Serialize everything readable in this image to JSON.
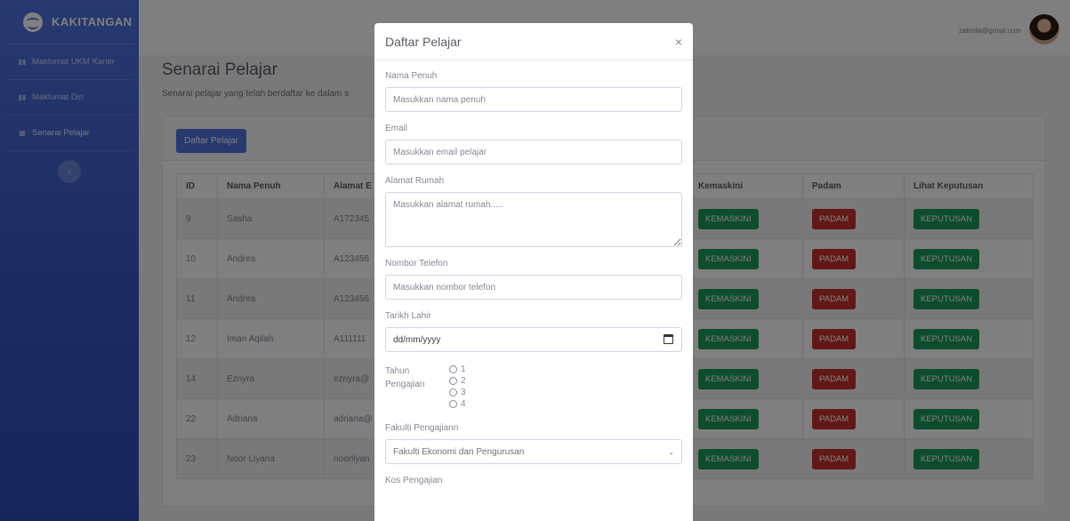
{
  "sidebar": {
    "brand": "KAKITANGAN",
    "items": [
      {
        "icon": "chart-icon",
        "label": "Maklumat UKM Karier"
      },
      {
        "icon": "chart-icon",
        "label": "Maklumat Diri"
      },
      {
        "icon": "table-icon",
        "label": "Senarai Pelajar"
      }
    ],
    "toggle_glyph": "‹"
  },
  "topbar": {
    "user_email": "zalinda@gmail.com"
  },
  "page": {
    "title": "Senarai Pelajar",
    "subtitle": "Senarai pelajar yang telah berdaftar ke dalam s",
    "add_button": "Daftar Pelajar"
  },
  "table": {
    "headers": [
      "ID",
      "Nama Penuh",
      "Alamat E",
      "Kemaskini",
      "Padam",
      "Lihat Keputusan"
    ],
    "rows": [
      {
        "id": "9",
        "name": "Sasha",
        "email": "A172345"
      },
      {
        "id": "10",
        "name": "Andrea",
        "email": "A123456"
      },
      {
        "id": "11",
        "name": "Andrea",
        "email": "A123456"
      },
      {
        "id": "12",
        "name": "Iman Aqilah",
        "email": "A111111"
      },
      {
        "id": "14",
        "name": "Eznyra",
        "email": "eznyra@"
      },
      {
        "id": "22",
        "name": "Adriana",
        "email": "adriana@"
      },
      {
        "id": "23",
        "name": "Noor Liyana",
        "email": "noorliyan"
      }
    ],
    "edit_label": "KEMASKINI",
    "delete_label": "PADAM",
    "result_label": "KEPUTUSAN"
  },
  "modal": {
    "title": "Daftar Pelajar",
    "close_glyph": "×",
    "name_label": "Nama Penuh",
    "name_placeholder": "Masukkan nama penuh",
    "email_label": "Email",
    "email_placeholder": "Masukkan email pelajar",
    "address_label": "Alamat Rumah",
    "address_placeholder": "Masukkan alamat rumah.....",
    "phone_label": "Nombor Telefon",
    "phone_placeholder": "Masukkan nombor telefon",
    "dob_label": "Tarikh Lahir",
    "dob_value": "dd/mm/yyyy",
    "year_label_1": "Tahun",
    "year_label_2": "Pengajian",
    "year_options": [
      "1",
      "2",
      "3",
      "4"
    ],
    "faculty_label": "Fakulti Pengajiann",
    "faculty_selected": "Fakulti Ekonomi dan Pengurusan",
    "course_label": "Kos Pengajian"
  },
  "colors": {
    "primary": "#4e73df",
    "success": "#1a9a5a",
    "danger": "#c9302c"
  }
}
